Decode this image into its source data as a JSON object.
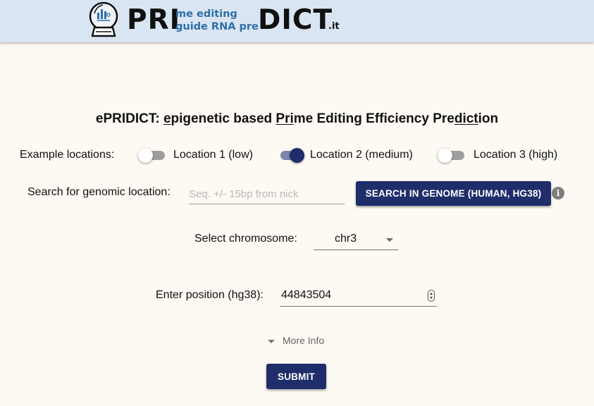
{
  "header": {
    "logo_pri": "PRI",
    "logo_sub_line1": "me editing",
    "logo_sub_line2": "guide RNA pre",
    "logo_dict": "DICT",
    "logo_suffix": ".it",
    "logo_icon": "crystal-ball-icon"
  },
  "title": {
    "part1": "ePRIDICT: ",
    "part2_u": "e",
    "part3": "pigenetic based ",
    "part4_u": "Pri",
    "part5": "me Editing Efficiency Pre",
    "part6_u": "dict",
    "part7": "ion"
  },
  "examples": {
    "label": "Example locations:",
    "options": [
      {
        "label": "Location 1 (low)",
        "checked": false
      },
      {
        "label": "Location 2 (medium)",
        "checked": true
      },
      {
        "label": "Location 3 (high)",
        "checked": false
      }
    ]
  },
  "search": {
    "label": "Search for genomic location:",
    "placeholder": "Seq. +/- 15bp from nick",
    "value": "",
    "button_label": "SEARCH IN GENOME (HUMAN, HG38)",
    "info_icon": "info-icon",
    "info_glyph": "i"
  },
  "chromosome": {
    "label": "Select chromosome:",
    "selected": "chr3"
  },
  "position": {
    "label": "Enter position (hg38):",
    "value": "44843504"
  },
  "more_info": {
    "label": "More Info"
  },
  "submit": {
    "label": "SUBMIT"
  },
  "colors": {
    "header_bg": "#d9e5f2",
    "page_bg": "#fdfaf3",
    "primary": "#1f2d6b",
    "logo_sub": "#2e6fa8"
  }
}
